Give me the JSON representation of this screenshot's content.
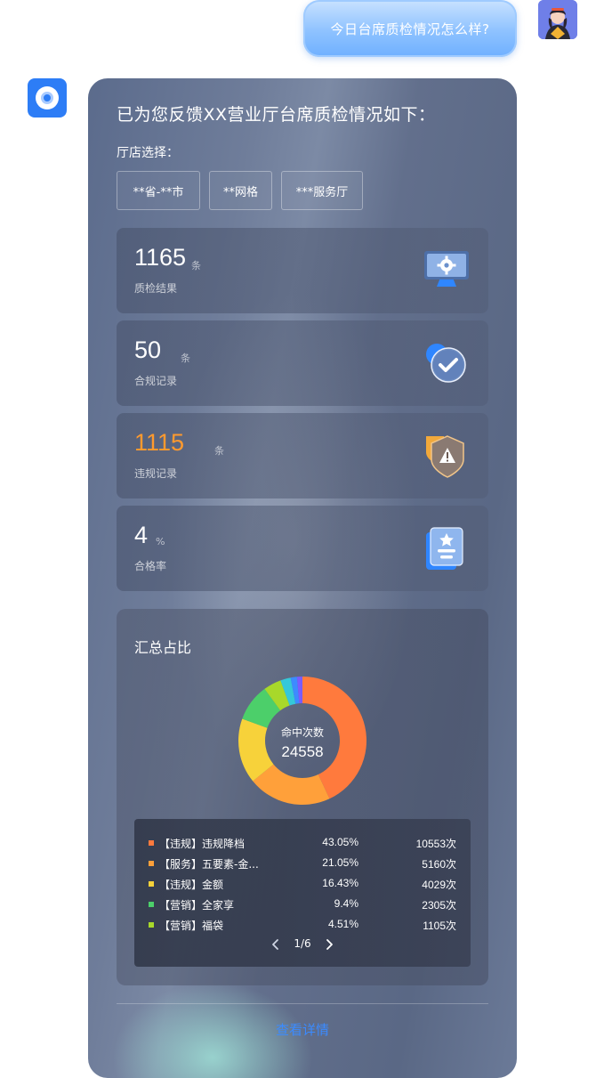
{
  "user_message": "今日台席质检情况怎么样?",
  "reply_title": "已为您反馈XX营业厅台席质检情况如下：",
  "store_select": {
    "label": "厅店选择：",
    "chips": [
      "**省-**市",
      "**网格",
      "***服务厅"
    ]
  },
  "stats": [
    {
      "value": "1165",
      "unit": "条",
      "label": "质检结果",
      "value_color": "#ffffff",
      "icon": "monitor-gear-icon"
    },
    {
      "value": "50",
      "unit": "条",
      "label": "合规记录",
      "value_color": "#ffffff",
      "icon": "check-badge-icon"
    },
    {
      "value": "1115",
      "unit": "条",
      "label": "违规记录",
      "value_color": "#ff9a2e",
      "icon": "warning-shield-icon"
    },
    {
      "value": "4",
      "unit": "%",
      "label": "合格率",
      "value_color": "#ffffff",
      "icon": "star-card-icon"
    }
  ],
  "summary": {
    "title": "汇总占比",
    "center_label": "命中次数",
    "center_value": "24558",
    "pager": "1/6"
  },
  "chart_data": {
    "type": "pie",
    "series": [
      {
        "name": "【违规】违规降档",
        "percent": 43.05,
        "count": "10553次",
        "pct_label": "43.05%",
        "color": "#ff7a3d"
      },
      {
        "name": "【服务】五要素-金...",
        "percent": 21.05,
        "count": "5160次",
        "pct_label": "21.05%",
        "color": "#ffa03a"
      },
      {
        "name": "【违规】金额",
        "percent": 16.43,
        "count": "4029次",
        "pct_label": "16.43%",
        "color": "#f7d23a"
      },
      {
        "name": "【营销】全家享",
        "percent": 9.4,
        "count": "2305次",
        "pct_label": "9.4%",
        "color": "#4ccf6a"
      },
      {
        "name": "【营销】福袋",
        "percent": 4.51,
        "count": "1105次",
        "pct_label": "4.51%",
        "color": "#a8d82a"
      }
    ],
    "other_slices": [
      {
        "percent": 2.6,
        "color": "#35c8d8"
      },
      {
        "percent": 1.6,
        "color": "#3d8bff"
      },
      {
        "percent": 1.36,
        "color": "#7a5cff"
      }
    ]
  },
  "detail_link": "查看详情"
}
